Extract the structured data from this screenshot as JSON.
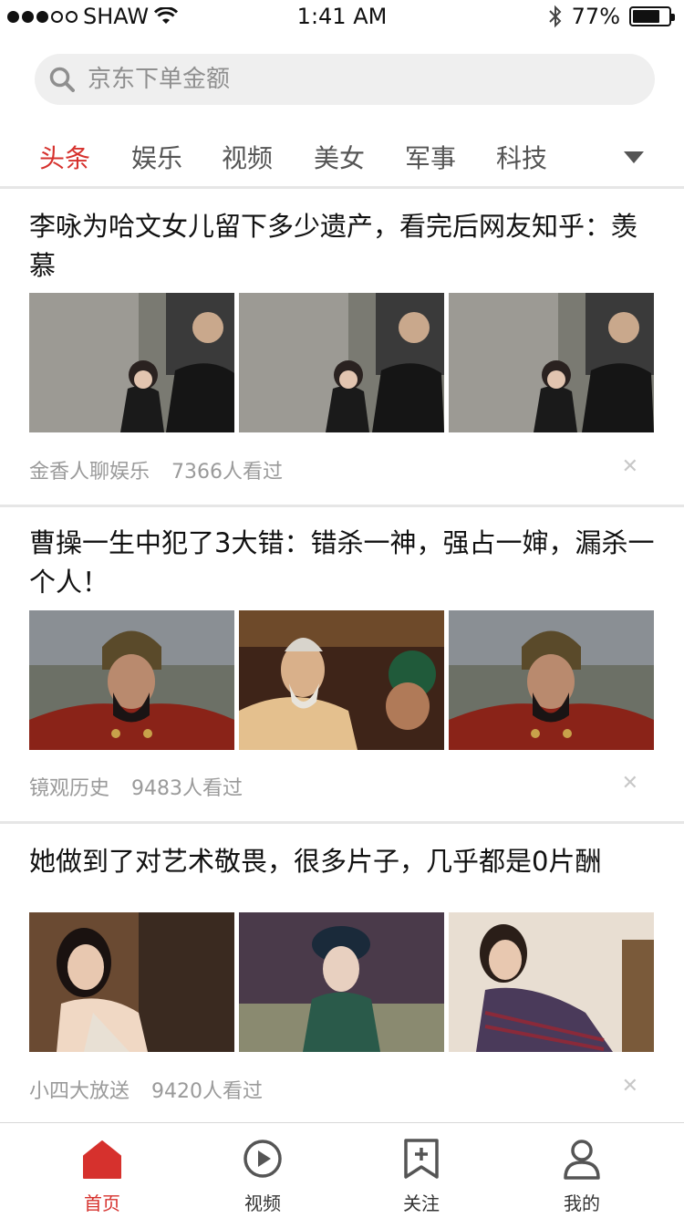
{
  "status_bar": {
    "carrier": "SHAW",
    "time": "1:41 AM",
    "battery": "77%"
  },
  "search": {
    "placeholder": "京东下单金额"
  },
  "tabs": [
    {
      "label": "头条",
      "active": true
    },
    {
      "label": "娱乐"
    },
    {
      "label": "视频"
    },
    {
      "label": "美女"
    },
    {
      "label": "军事"
    },
    {
      "label": "科技"
    }
  ],
  "articles": [
    {
      "title": "李咏为哈文女儿留下多少遗产，看完后网友知乎：羡慕",
      "source": "金香人聊娱乐",
      "views": "7366人看过"
    },
    {
      "title": "曹操一生中犯了3大错：错杀一神，强占一婶，漏杀一个人！",
      "source": "镜观历史",
      "views": "9483人看过"
    },
    {
      "title": "她做到了对艺术敬畏，很多片子，几乎都是0片酬",
      "source": "小四大放送",
      "views": "9420人看过"
    }
  ],
  "bottom_nav": [
    {
      "label": "首页",
      "icon": "home-icon",
      "active": true
    },
    {
      "label": "视频",
      "icon": "play-circle-icon"
    },
    {
      "label": "关注",
      "icon": "bookmark-plus-icon"
    },
    {
      "label": "我的",
      "icon": "user-icon"
    }
  ],
  "colors": {
    "accent": "#d6312d",
    "divider": "#e6e6e6",
    "search_bg": "#efefef"
  }
}
